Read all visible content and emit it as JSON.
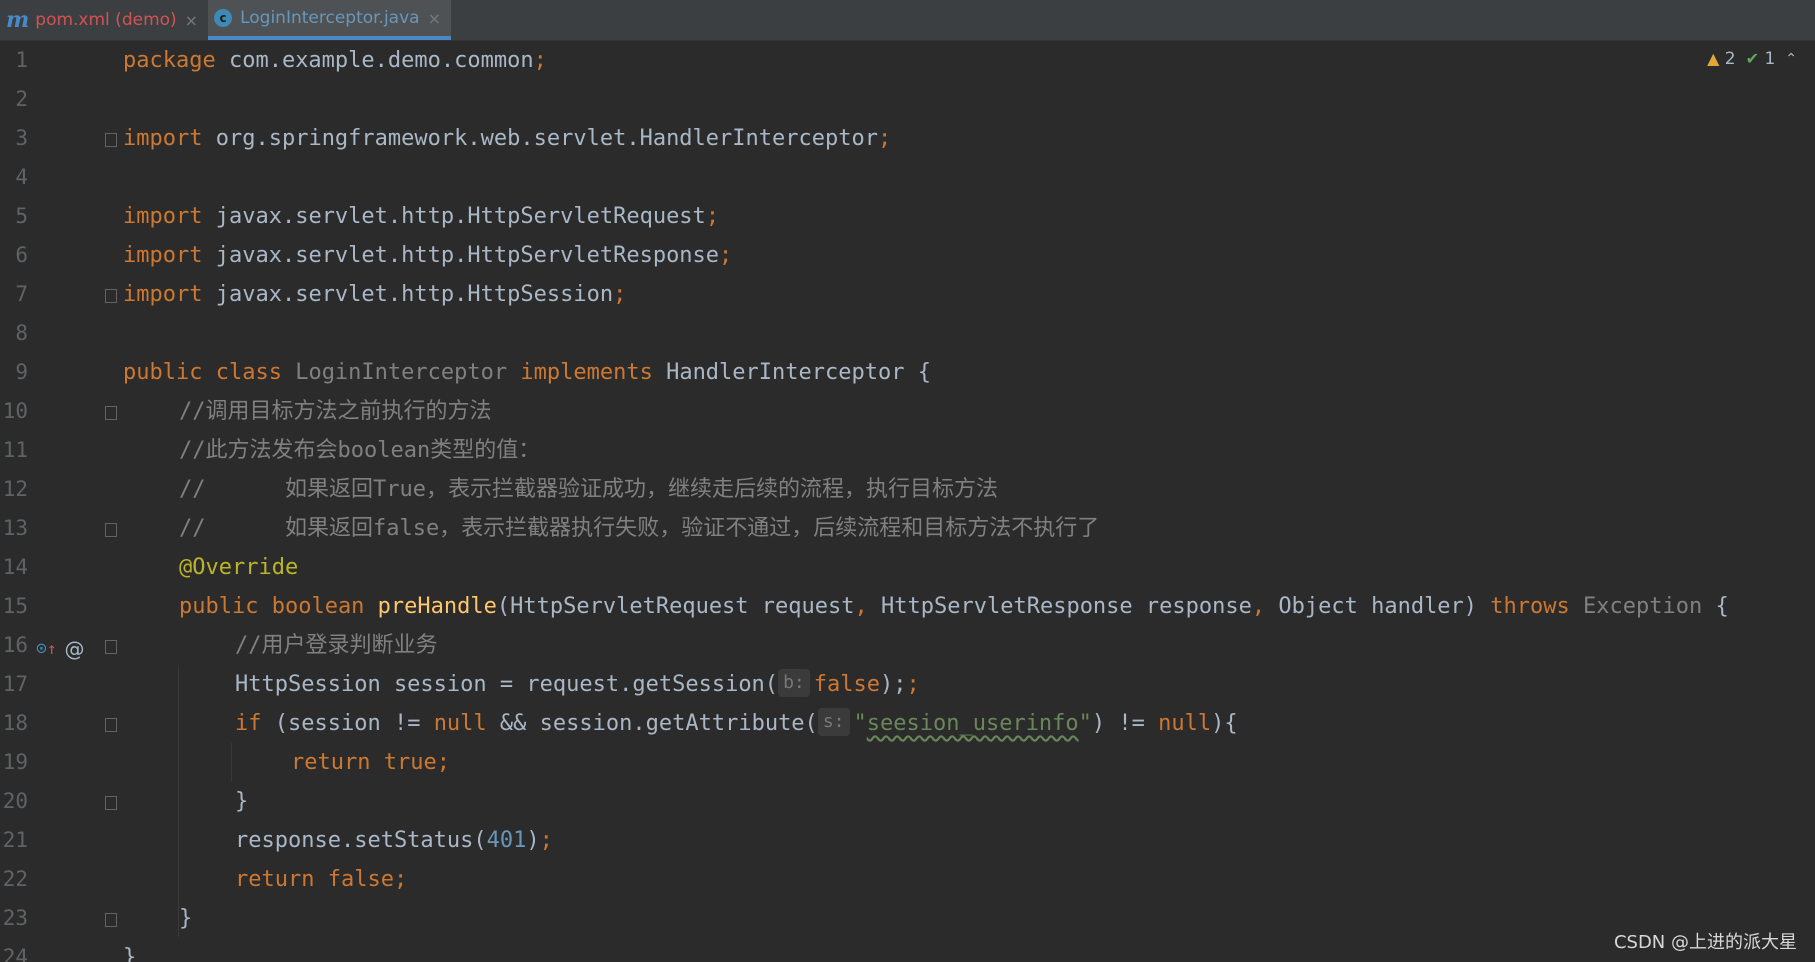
{
  "tabs": [
    {
      "icon": "maven-icon",
      "glyph": "m",
      "label": "pom.xml (demo)",
      "active": false
    },
    {
      "icon": "java-class-icon",
      "glyph": "c",
      "label": "LoginInterceptor.java",
      "active": true
    }
  ],
  "close_glyph": "×",
  "status": {
    "warnings": "2",
    "ok": "1",
    "warn_glyph": "▲",
    "ok_glyph": "✔",
    "chevron": "⌃"
  },
  "gutter": {
    "override_glyph": "⊙",
    "override_arrow": "↑",
    "at_glyph": "@"
  },
  "line_numbers": [
    "1",
    "2",
    "3",
    "4",
    "5",
    "6",
    "7",
    "8",
    "9",
    "10",
    "11",
    "12",
    "13",
    "14",
    "15",
    "16",
    "17",
    "18",
    "19",
    "20",
    "21",
    "22",
    "23",
    "24"
  ],
  "code": {
    "l1_kw": "package",
    "l1_rest": " com.example.demo.common",
    "semi": ";",
    "l3_kw": "import",
    "l3_rest": " org.springframework.web.servlet.HandlerInterceptor",
    "l5_rest": " javax.servlet.http.HttpServletRequest",
    "l6_rest": " javax.servlet.http.HttpServletResponse",
    "l7_rest": " javax.servlet.http.HttpSession",
    "l9_kw1": "public class",
    "l9_cls": " LoginInterceptor",
    "l9_kw2": " implements",
    "l9_rest": " HandlerInterceptor {",
    "l10": "//调用目标方法之前执行的方法",
    "l11": "//此方法发布会boolean类型的值：",
    "l12": "//      如果返回True，表示拦截器验证成功，继续走后续的流程，执行目标方法",
    "l13": "//      如果返回false，表示拦截器执行失败，验证不通过，后续流程和目标方法不执行了",
    "l14": "@Override",
    "l15_kw": "public boolean",
    "l15_fn": " preHandle",
    "l15_a": "(HttpServletRequest request",
    "l15_comma": ",",
    "l15_b": " HttpServletResponse response",
    "l15_c": " Object handler) ",
    "l15_throws": "throws",
    "l15_exc": " Exception ",
    "l15_brace": "{",
    "l16": "//用户登录判断业务",
    "l17_a": "HttpSession session = request.getSession(",
    "l17_hint": "b:",
    "l17_false": "false",
    "l17_end": ");",
    "l18_if": "if",
    "l18_a": " (session != ",
    "l18_null": "null",
    "l18_b": " && session.getAttribute(",
    "l18_hint": "s:",
    "l18_q1": "\"",
    "l18_str": "seesion_userinfo",
    "l18_q2": "\"",
    "l18_c": ") != ",
    "l18_null2": "null",
    "l18_d": "){",
    "l19": "return true;",
    "l20": "}",
    "l21_a": "response.setStatus(",
    "l21_num": "401",
    "l21_b": ")",
    "l22": "return false;",
    "l23": "}",
    "l24": "}"
  },
  "watermark": "CSDN @上进的派大星",
  "colors": {
    "keyword": "#cc7832",
    "comment": "#808080",
    "string": "#6a8759",
    "number": "#6897bb",
    "annotation": "#bbb529",
    "method": "#ffc66d",
    "text": "#a9b7c6",
    "background": "#2b2b2b"
  }
}
